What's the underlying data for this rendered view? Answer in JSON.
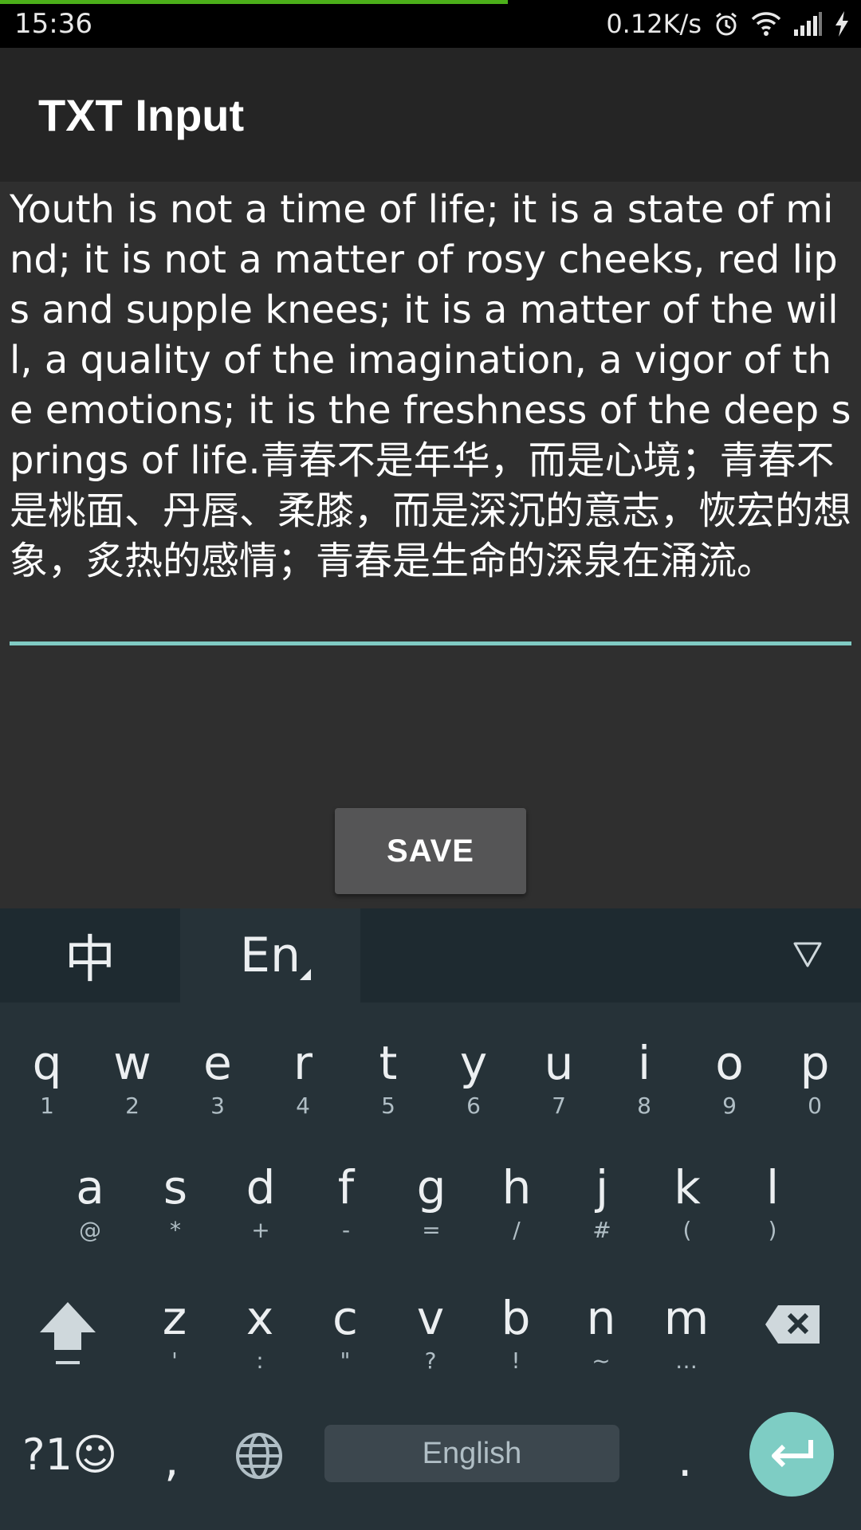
{
  "status_bar": {
    "time": "15:36",
    "net_speed": "0.12K/s",
    "icons": [
      "alarm-icon",
      "wifi-icon",
      "signal-icon",
      "charging-icon"
    ],
    "load_color": "#4caf1a"
  },
  "app_bar": {
    "title": "TXT Input"
  },
  "editor": {
    "value": "Youth is not a time of life; it is a state of mind; it is not a matter of rosy cheeks, red lips and supple knees; it is a matter of the will, a quality of the imagination, a vigor of the emotions; it is the freshness of the deep springs of life.青春不是年华，而是心境；青春不是桃面、丹唇、柔膝，而是深沉的意志，恢宏的想象，炙热的感情；青春是生命的深泉在涌流。",
    "underline_color": "#80cbc4"
  },
  "save_button": {
    "label": "SAVE"
  },
  "keyboard": {
    "lang_tabs": {
      "chinese": "中",
      "english": "En"
    },
    "collapse_icon": "triangle-down-icon",
    "row1": [
      {
        "k": "q",
        "s": "1"
      },
      {
        "k": "w",
        "s": "2"
      },
      {
        "k": "e",
        "s": "3"
      },
      {
        "k": "r",
        "s": "4"
      },
      {
        "k": "t",
        "s": "5"
      },
      {
        "k": "y",
        "s": "6"
      },
      {
        "k": "u",
        "s": "7"
      },
      {
        "k": "i",
        "s": "8"
      },
      {
        "k": "o",
        "s": "9"
      },
      {
        "k": "p",
        "s": "0"
      }
    ],
    "row2": [
      {
        "k": "a",
        "s": "@"
      },
      {
        "k": "s",
        "s": "*"
      },
      {
        "k": "d",
        "s": "+"
      },
      {
        "k": "f",
        "s": "-"
      },
      {
        "k": "g",
        "s": "="
      },
      {
        "k": "h",
        "s": "/"
      },
      {
        "k": "j",
        "s": "#"
      },
      {
        "k": "k",
        "s": "("
      },
      {
        "k": "l",
        "s": ")"
      }
    ],
    "row3": [
      {
        "k": "z",
        "s": "'"
      },
      {
        "k": "x",
        "s": ":"
      },
      {
        "k": "c",
        "s": "\""
      },
      {
        "k": "v",
        "s": "?"
      },
      {
        "k": "b",
        "s": "!"
      },
      {
        "k": "n",
        "s": "~"
      },
      {
        "k": "m",
        "s": "…"
      }
    ],
    "symbols_key": "?1☺",
    "comma_key": ",",
    "period_key": ".",
    "space_label": "English",
    "accent_color": "#7ecdc4"
  }
}
